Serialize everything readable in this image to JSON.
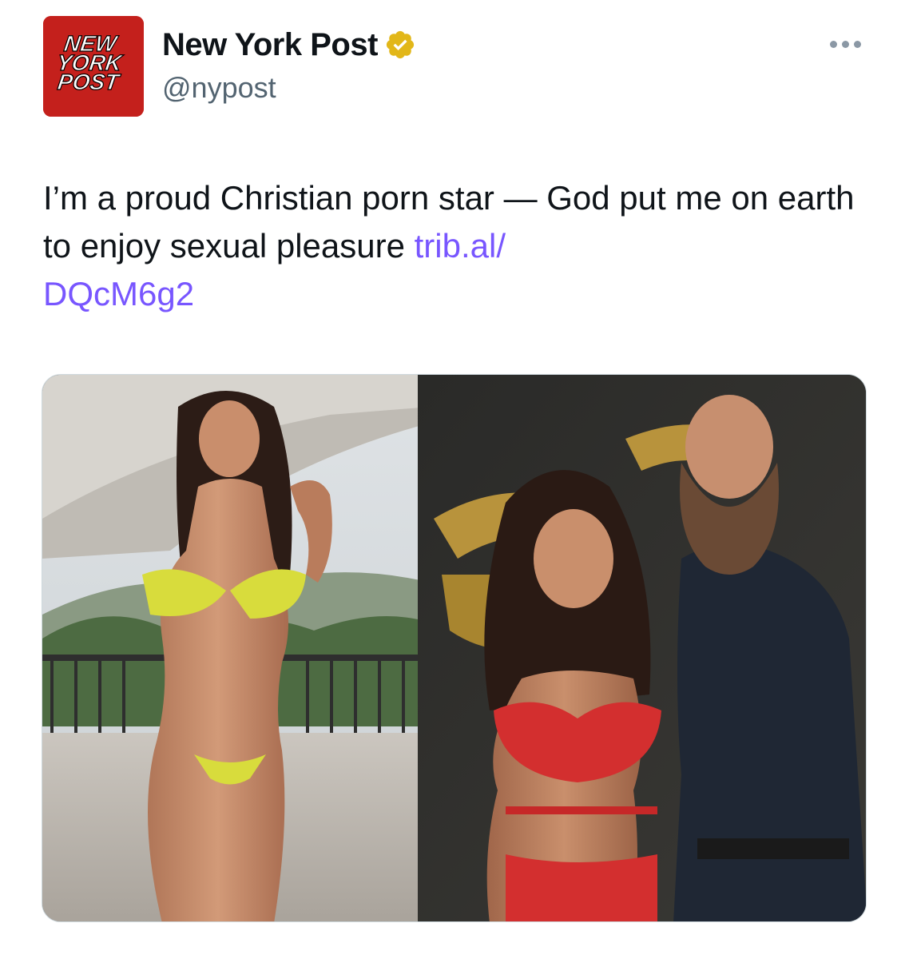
{
  "account": {
    "avatar_text": [
      "NEW",
      "YORK",
      "POST"
    ],
    "display_name": "New York Post",
    "handle": "@nypost",
    "verified": true,
    "verified_icon": "verified-gold-badge-icon",
    "brand_color": "#c4201c",
    "badge_color": "#e2b719"
  },
  "tweet": {
    "text": "I’m a proud Christian porn star — God put me on earth to enjoy sexual pleasure ",
    "link_text_1": "trib.al/",
    "link_text_2": "DQcM6g2",
    "link_color": "#7856ff"
  },
  "menu": {
    "icon": "more-options-icon"
  },
  "media": {
    "left_photo": "photo of woman in yellow bikini on balcony",
    "right_photo": "photo of woman in red outfit and bearded man at event"
  }
}
